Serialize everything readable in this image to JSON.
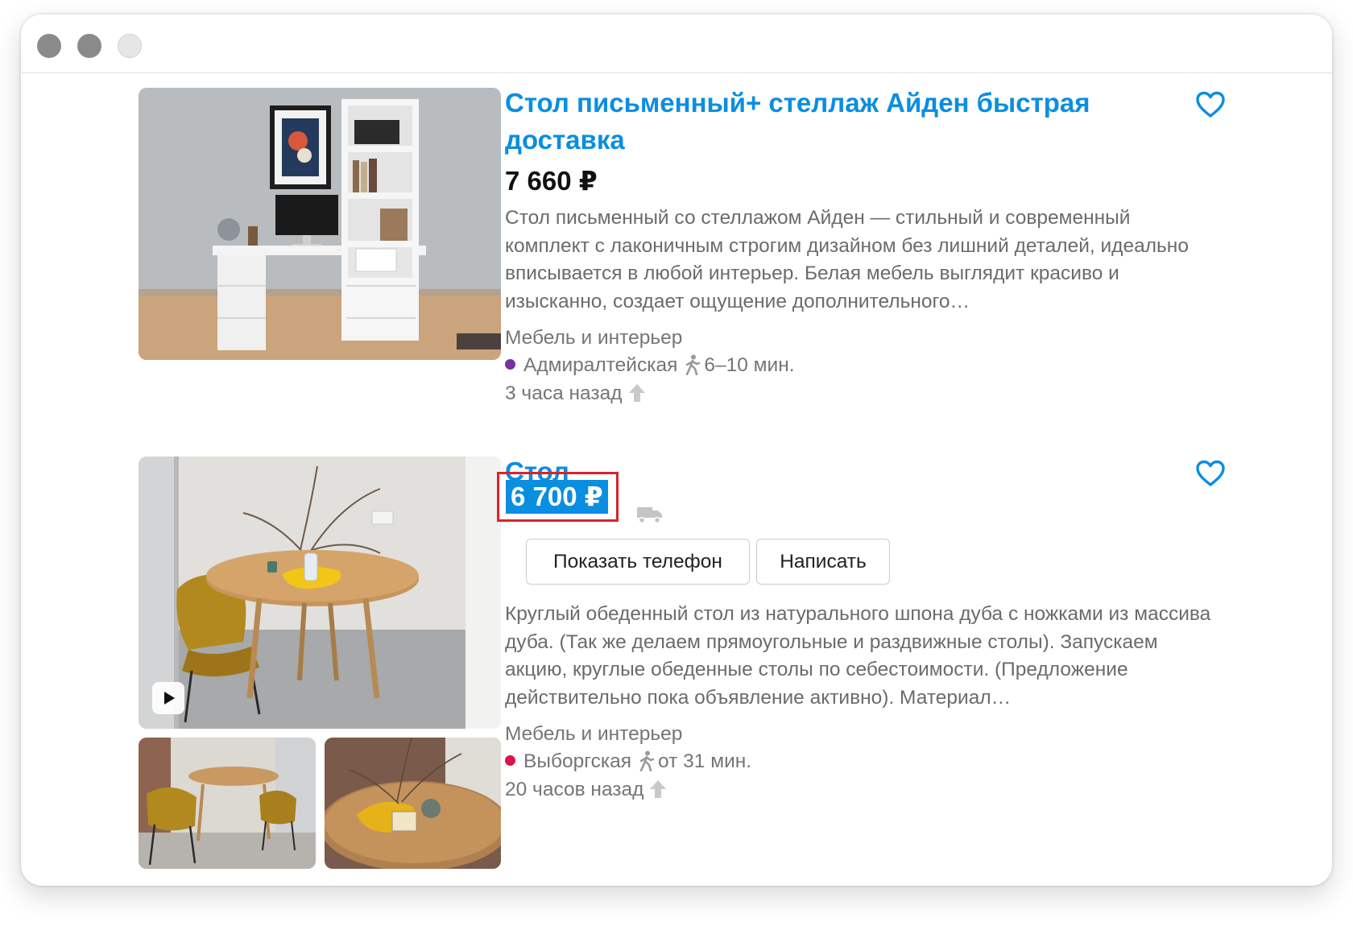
{
  "window": {
    "controls": [
      "close",
      "minimize",
      "maximize"
    ]
  },
  "listings": [
    {
      "title": "Стол письменный+ стеллаж Айден быстрая доставка",
      "price": "7 660 ₽",
      "description": "Стол письменный со стеллажом Айден — стильный и современный комплект с лаконичным строгим дизайном без лишний деталей, идеально вписывается в любой интерьер. Белая мебель выглядит красиво и изысканно, создает ощущение дополнительного…",
      "category": "Мебель и интерьер",
      "metro": "Адмиралтейская",
      "metro_color": "#7b2fa0",
      "walk_time": "6–10 мин.",
      "posted": "3 часа назад",
      "image": "white-desk-with-shelving-photo"
    },
    {
      "title": "Стол",
      "price": "6 700 ₽",
      "delivery_icon": "truck-icon",
      "buttons": {
        "phone": "Показать телефон",
        "message": "Написать"
      },
      "description": "Круглый обеденный стол из натурального шпона дуба с ножками из массива дуба. (Так же делаем прямоугольные и раздвижные столы). Запускаем акцию, круглые обеденные столы по себестоимости. (Предложение действительно пока объявление активно). Материал…",
      "category": "Мебель и интерьер",
      "metro": "Выборгская",
      "metro_color": "#d8144a",
      "walk_time": "от 31 мин.",
      "posted": "20 часов назад",
      "images": [
        "round-table-video-thumbnail",
        "round-table-with-chairs-photo",
        "round-table-closeup-photo"
      ]
    }
  ],
  "colors": {
    "title": "#0a8ee0",
    "price_highlight": "#0a8ee0",
    "highlight_border": "#d8242a",
    "muted_text": "#6b6b6b"
  }
}
